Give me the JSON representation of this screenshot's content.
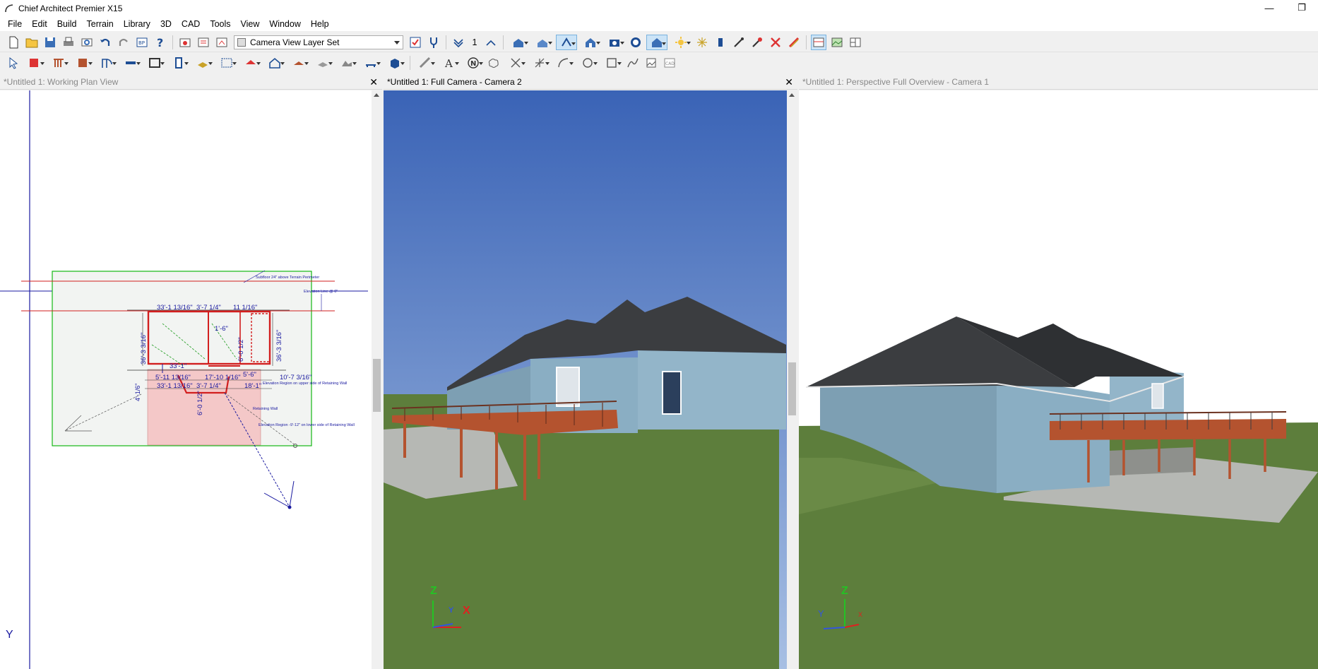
{
  "window": {
    "title": "Chief Architect Premier X15",
    "minimize": "—",
    "restore": "❐"
  },
  "menu": [
    "File",
    "Edit",
    "Build",
    "Terrain",
    "Library",
    "3D",
    "CAD",
    "Tools",
    "View",
    "Window",
    "Help"
  ],
  "toolbar": {
    "layer_set": "Camera View Layer Set",
    "floor_number": "1"
  },
  "panes": {
    "plan": {
      "tab": "*Untitled 1:  Working Plan View",
      "close": "✕",
      "axis_y": "Y",
      "dimensions": {
        "d1": "33'-1 13/16\"",
        "d2": "3'-7 1/4\"",
        "d3": "11 1/16\"",
        "d4": "36'-3 3/16\"",
        "d5": "1'-6\"",
        "d6": "6'-0 1/2\"",
        "d7": "33'-1\"",
        "d8": "5'-11 13/16\"",
        "d9": "5'-6\"",
        "d10": "10'-7 3/16\"",
        "d11": "17'-10 1/16\"",
        "d12": "33'-1 13/16\"",
        "d13": "3'-7 1/4\"",
        "d14": "18'-1\"",
        "d15": "4'-1/6\"",
        "d16": "6'-0 1/2\""
      },
      "notes": {
        "n1": "Subfloor 24\" above Terrain Perimeter",
        "n2": "Elevation Line @ 0\"",
        "n3": "Elevation Region on upper side of Retaining Wall",
        "n4": "Retaining Wall",
        "n5": "Elevation Region -9'-12\" on lower side of Retaining Wall"
      }
    },
    "camera": {
      "tab": "*Untitled 1: Full Camera - Camera 2",
      "close": "✕",
      "axis_z": "Z",
      "axis_x": "X",
      "axis_y": "Y"
    },
    "overview": {
      "tab": "*Untitled 1: Perspective Full Overview - Camera 1",
      "axis_z": "Z",
      "axis_x": "X",
      "axis_y": "Y"
    }
  },
  "colors": {
    "sky_top": "#3a63b6",
    "sky_bottom": "#a7bfe3",
    "grass": "#5d7e3c",
    "siding": "#8aaec3",
    "roof": "#3b3d40",
    "deck": "#b4532f",
    "plan_line": "#1a1aa0",
    "plan_red": "#d21f1f",
    "plan_green": "#14b814"
  }
}
